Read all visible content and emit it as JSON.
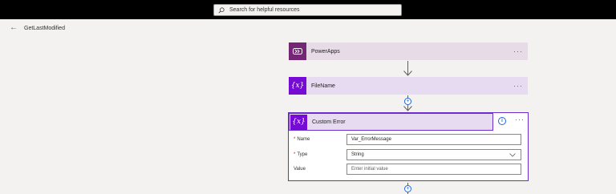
{
  "search": {
    "placeholder": "Search for helpful resources"
  },
  "flow": {
    "name": "GetLastModified"
  },
  "steps": [
    {
      "label": "PowerApps"
    },
    {
      "label": "FileName"
    }
  ],
  "expanded_step": {
    "label": "Custom Error",
    "fields": [
      {
        "label": "Name",
        "required": "*",
        "value": "Var_ErrorMessage"
      },
      {
        "label": "Type",
        "required": "*",
        "value": "String"
      },
      {
        "label": "Value",
        "placeholder": "Enter initial value"
      }
    ]
  },
  "menu_glyph": "···",
  "variable_glyph": "{x}"
}
